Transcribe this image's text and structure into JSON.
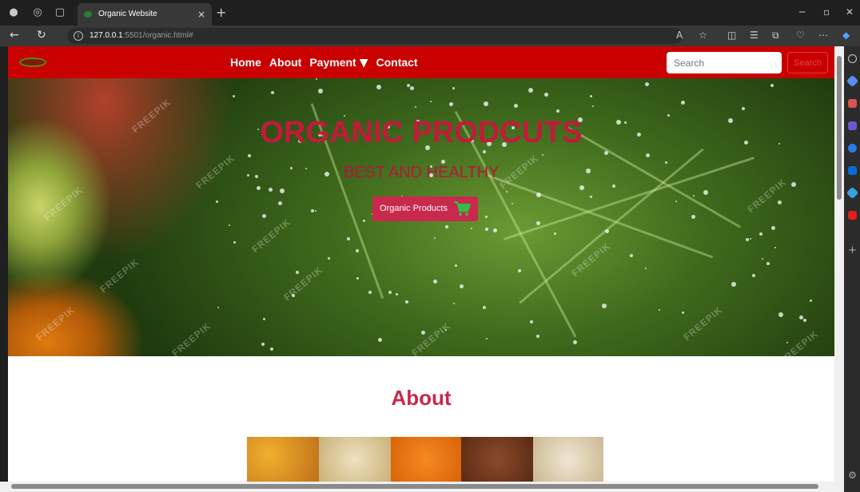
{
  "browser": {
    "tab_title": "Organic Website",
    "url_host": "127.0.0.1",
    "url_rest": ":5501/organic.html#"
  },
  "navbar": {
    "items": [
      "Home",
      "About",
      "Payment",
      "Contact"
    ],
    "search_placeholder": "Search",
    "search_button": "Search"
  },
  "hero": {
    "title": "ORGANIC PRODCUTS",
    "subtitle": "BEST AND HEALTHY",
    "cta_label": "Organic Products",
    "watermark": "FREEPIK"
  },
  "about": {
    "heading": "About"
  },
  "colors": {
    "navbar": "#c80000",
    "accent": "#c8294d"
  }
}
